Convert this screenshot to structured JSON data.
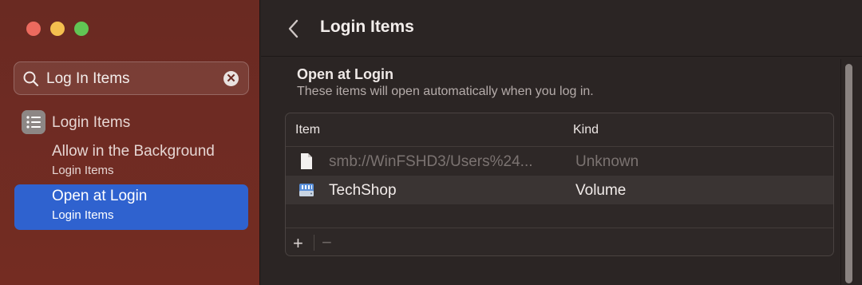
{
  "sidebar": {
    "search": {
      "value": "Log In Items"
    },
    "group": {
      "label": "Login Items",
      "icon": "list-icon"
    },
    "items": [
      {
        "title": "Allow in the Background",
        "subtitle": "Login Items"
      },
      {
        "title": "Open at Login",
        "subtitle": "Login Items",
        "selected": true
      }
    ]
  },
  "header": {
    "title": "Login Items"
  },
  "section": {
    "title": "Open at Login",
    "subtitle": "These items will open automatically when you log in."
  },
  "table": {
    "columns": [
      "Item",
      "Kind"
    ],
    "rows": [
      {
        "item": "smb://WinFSHD3/Users%24...",
        "kind": "Unknown",
        "icon": "document-icon"
      },
      {
        "item": "TechShop",
        "kind": "Volume",
        "icon": "server-volume-icon"
      }
    ],
    "add_label": "+",
    "remove_label": "−"
  },
  "colors": {
    "sidebar_bg": "#6e2b23",
    "selection": "#2f62cf",
    "main_bg": "#2b2524"
  }
}
